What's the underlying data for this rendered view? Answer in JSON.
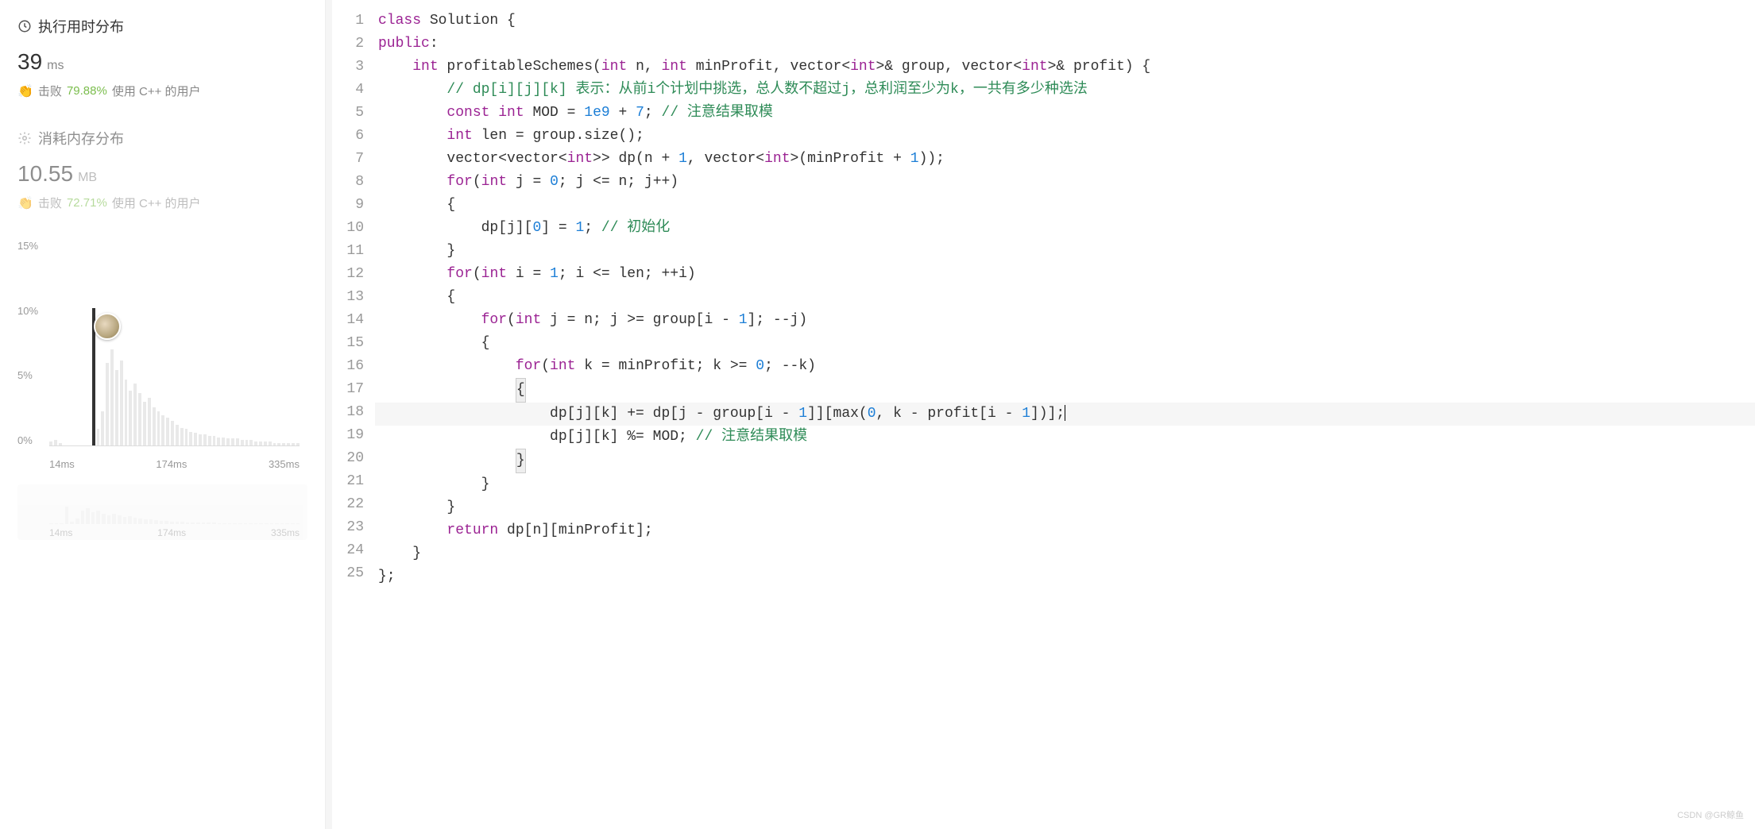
{
  "sidebar": {
    "runtime": {
      "title": "执行用时分布",
      "value": "39",
      "unit": "ms",
      "beat_label": "击败",
      "beat_pct": "79.88%",
      "beat_suffix": "使用 C++ 的用户"
    },
    "memory": {
      "title": "消耗内存分布",
      "value": "10.55",
      "unit": "MB",
      "beat_label": "击败",
      "beat_pct": "72.71%",
      "beat_suffix": "使用 C++ 的用户"
    },
    "y_ticks": [
      "15%",
      "10%",
      "5%",
      "0%"
    ],
    "x_ticks": [
      "14ms",
      "174ms",
      "335ms"
    ],
    "x_ticks2": [
      "14ms",
      "174ms",
      "335ms"
    ]
  },
  "chart_data": {
    "type": "bar",
    "title": "执行用时分布",
    "xlabel": "ms",
    "ylabel": "%",
    "ylim": [
      0,
      15
    ],
    "categories_ms": [
      "14",
      "174",
      "335"
    ],
    "bars_heights_pct": [
      0.3,
      0.4,
      0.2,
      10,
      1.2,
      2.5,
      6,
      7,
      5.5,
      6.2,
      4.8,
      4,
      4.5,
      3.8,
      3.2,
      3.5,
      2.8,
      2.5,
      2.2,
      2,
      1.8,
      1.5,
      1.3,
      1.2,
      1,
      0.9,
      0.8,
      0.8,
      0.7,
      0.7,
      0.6,
      0.6,
      0.5,
      0.5,
      0.5,
      0.4,
      0.4,
      0.4,
      0.3,
      0.3,
      0.3,
      0.3,
      0.2,
      0.2,
      0.2,
      0.2,
      0.2,
      0.2
    ],
    "highlighted_bar_ms": 39,
    "mini_bars_heights_pct": [
      0.3,
      0.4,
      0.2,
      8,
      1.2,
      2.5,
      6,
      7,
      5.5,
      6.2,
      4.8,
      4,
      4.5,
      3.8,
      3.2,
      3.5,
      2.8,
      2.5,
      2.2,
      2,
      1.8,
      1.5,
      1.3,
      1.2,
      1,
      0.9,
      0.8,
      0.8,
      0.7,
      0.7,
      0.6,
      0.6,
      0.5,
      0.5,
      0.5,
      0.4,
      0.4,
      0.4,
      0.3,
      0.3,
      0.3,
      0.3,
      0.2,
      0.2,
      0.2,
      0.2,
      0.2,
      0.2
    ]
  },
  "code": {
    "lines": [
      {
        "n": 1,
        "t": [
          {
            "c": "kw",
            "s": "class"
          },
          {
            "c": "",
            "s": " Solution {"
          }
        ]
      },
      {
        "n": 2,
        "t": [
          {
            "c": "kw",
            "s": "public"
          },
          {
            "c": "",
            "s": ":"
          }
        ]
      },
      {
        "n": 3,
        "t": [
          {
            "c": "",
            "s": "    "
          },
          {
            "c": "kw",
            "s": "int"
          },
          {
            "c": "",
            "s": " profitableSchemes("
          },
          {
            "c": "kw",
            "s": "int"
          },
          {
            "c": "",
            "s": " n, "
          },
          {
            "c": "kw",
            "s": "int"
          },
          {
            "c": "",
            "s": " minProfit, vector<"
          },
          {
            "c": "kw",
            "s": "int"
          },
          {
            "c": "",
            "s": ">& group, vector<"
          },
          {
            "c": "kw",
            "s": "int"
          },
          {
            "c": "",
            "s": ">& profit) {"
          }
        ]
      },
      {
        "n": 4,
        "t": [
          {
            "c": "",
            "s": "        "
          },
          {
            "c": "cmt",
            "s": "// dp[i][j][k] 表示：从前i个计划中挑选，总人数不超过j，总利润至少为k，一共有多少种选法"
          }
        ]
      },
      {
        "n": 5,
        "t": [
          {
            "c": "",
            "s": "        "
          },
          {
            "c": "kw",
            "s": "const"
          },
          {
            "c": "",
            "s": " "
          },
          {
            "c": "kw",
            "s": "int"
          },
          {
            "c": "",
            "s": " MOD = "
          },
          {
            "c": "num",
            "s": "1e9"
          },
          {
            "c": "",
            "s": " + "
          },
          {
            "c": "num",
            "s": "7"
          },
          {
            "c": "",
            "s": "; "
          },
          {
            "c": "cmt",
            "s": "// 注意结果取模"
          }
        ]
      },
      {
        "n": 6,
        "t": [
          {
            "c": "",
            "s": "        "
          },
          {
            "c": "kw",
            "s": "int"
          },
          {
            "c": "",
            "s": " len = group.size();"
          }
        ]
      },
      {
        "n": 7,
        "t": [
          {
            "c": "",
            "s": "        vector<vector<"
          },
          {
            "c": "kw",
            "s": "int"
          },
          {
            "c": "",
            "s": ">> dp(n + "
          },
          {
            "c": "num",
            "s": "1"
          },
          {
            "c": "",
            "s": ", vector<"
          },
          {
            "c": "kw",
            "s": "int"
          },
          {
            "c": "",
            "s": ">(minProfit + "
          },
          {
            "c": "num",
            "s": "1"
          },
          {
            "c": "",
            "s": "));"
          }
        ]
      },
      {
        "n": 8,
        "t": [
          {
            "c": "",
            "s": "        "
          },
          {
            "c": "kw",
            "s": "for"
          },
          {
            "c": "",
            "s": "("
          },
          {
            "c": "kw",
            "s": "int"
          },
          {
            "c": "",
            "s": " j = "
          },
          {
            "c": "num",
            "s": "0"
          },
          {
            "c": "",
            "s": "; j <= n; j++)"
          }
        ]
      },
      {
        "n": 9,
        "t": [
          {
            "c": "",
            "s": "        {"
          }
        ]
      },
      {
        "n": 10,
        "t": [
          {
            "c": "",
            "s": "            dp[j]["
          },
          {
            "c": "num",
            "s": "0"
          },
          {
            "c": "",
            "s": "] = "
          },
          {
            "c": "num",
            "s": "1"
          },
          {
            "c": "",
            "s": "; "
          },
          {
            "c": "cmt",
            "s": "// 初始化"
          }
        ]
      },
      {
        "n": 11,
        "t": [
          {
            "c": "",
            "s": "        }"
          }
        ]
      },
      {
        "n": 12,
        "t": [
          {
            "c": "",
            "s": "        "
          },
          {
            "c": "kw",
            "s": "for"
          },
          {
            "c": "",
            "s": "("
          },
          {
            "c": "kw",
            "s": "int"
          },
          {
            "c": "",
            "s": " i = "
          },
          {
            "c": "num",
            "s": "1"
          },
          {
            "c": "",
            "s": "; i <= len; ++i)"
          }
        ]
      },
      {
        "n": 13,
        "t": [
          {
            "c": "",
            "s": "        {"
          }
        ]
      },
      {
        "n": 14,
        "t": [
          {
            "c": "",
            "s": "            "
          },
          {
            "c": "kw",
            "s": "for"
          },
          {
            "c": "",
            "s": "("
          },
          {
            "c": "kw",
            "s": "int"
          },
          {
            "c": "",
            "s": " j = n; j >= group[i - "
          },
          {
            "c": "num",
            "s": "1"
          },
          {
            "c": "",
            "s": "]; --j)"
          }
        ]
      },
      {
        "n": 15,
        "t": [
          {
            "c": "",
            "s": "            {"
          }
        ]
      },
      {
        "n": 16,
        "t": [
          {
            "c": "",
            "s": "                "
          },
          {
            "c": "kw",
            "s": "for"
          },
          {
            "c": "",
            "s": "("
          },
          {
            "c": "kw",
            "s": "int"
          },
          {
            "c": "",
            "s": " k = minProfit; k >= "
          },
          {
            "c": "num",
            "s": "0"
          },
          {
            "c": "",
            "s": "; --k)"
          }
        ]
      },
      {
        "n": 17,
        "t": [
          {
            "c": "",
            "s": "                "
          },
          {
            "c": "hl-rect",
            "s": "{"
          }
        ]
      },
      {
        "n": 18,
        "hl": true,
        "t": [
          {
            "c": "",
            "s": "                    dp[j][k] += dp[j - group[i - "
          },
          {
            "c": "num",
            "s": "1"
          },
          {
            "c": "",
            "s": "]][max("
          },
          {
            "c": "num",
            "s": "0"
          },
          {
            "c": "",
            "s": ", k - profit[i - "
          },
          {
            "c": "num",
            "s": "1"
          },
          {
            "c": "",
            "s": "])];"
          },
          {
            "c": "cursor",
            "s": ""
          }
        ]
      },
      {
        "n": 19,
        "t": [
          {
            "c": "",
            "s": "                    dp[j][k] %= MOD; "
          },
          {
            "c": "cmt",
            "s": "// 注意结果取模"
          }
        ]
      },
      {
        "n": 20,
        "t": [
          {
            "c": "",
            "s": "                "
          },
          {
            "c": "hl-rect",
            "s": "}"
          }
        ]
      },
      {
        "n": 21,
        "t": [
          {
            "c": "",
            "s": "            }"
          }
        ]
      },
      {
        "n": 22,
        "t": [
          {
            "c": "",
            "s": "        }"
          }
        ]
      },
      {
        "n": 23,
        "t": [
          {
            "c": "",
            "s": "        "
          },
          {
            "c": "kw",
            "s": "return"
          },
          {
            "c": "",
            "s": " dp[n][minProfit];"
          }
        ]
      },
      {
        "n": 24,
        "t": [
          {
            "c": "",
            "s": "    }"
          }
        ]
      },
      {
        "n": 25,
        "t": [
          {
            "c": "",
            "s": "};"
          }
        ]
      }
    ]
  },
  "watermark": "CSDN @GR鲸鱼"
}
